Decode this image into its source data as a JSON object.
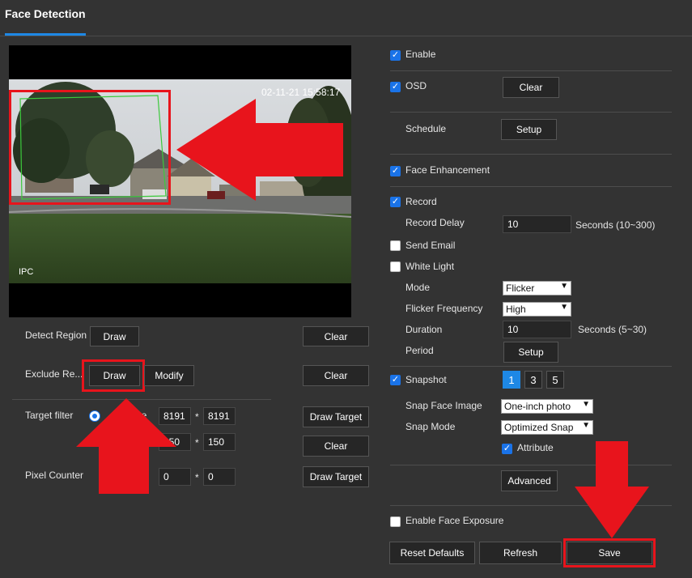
{
  "page": {
    "tab_title": "Face Detection"
  },
  "video": {
    "timestamp": "02-11-21 15:58:17",
    "channel_label": "IPC"
  },
  "left": {
    "detect_region_label": "Detect Region",
    "detect_draw": "Draw",
    "detect_clear": "Clear",
    "exclude_label": "Exclude Re...",
    "exclude_draw": "Draw",
    "exclude_modify": "Modify",
    "exclude_clear": "Clear",
    "target_filter_label": "Target filter",
    "size_label": "Size",
    "max_w": "8191",
    "max_h": "8191",
    "min_w": "150",
    "min_h": "150",
    "times": "*",
    "draw_target_1": "Draw Target",
    "clear_target": "Clear",
    "pixel_counter_label": "Pixel Counter",
    "pixel_w": "0",
    "pixel_h": "0",
    "draw_target_2": "Draw Target"
  },
  "right": {
    "enable": "Enable",
    "osd": "OSD",
    "osd_clear": "Clear",
    "schedule": "Schedule",
    "schedule_setup": "Setup",
    "face_enhancement": "Face Enhancement",
    "record": "Record",
    "record_delay": "Record Delay",
    "record_delay_value": "10",
    "record_delay_unit": "Seconds (10~300)",
    "send_email": "Send Email",
    "white_light": "White Light",
    "mode": "Mode",
    "mode_value": "Flicker",
    "flicker_frequency": "Flicker Frequency",
    "flicker_value": "High",
    "duration": "Duration",
    "duration_value": "10",
    "duration_unit": "Seconds (5~30)",
    "period": "Period",
    "period_setup": "Setup",
    "snapshot": "Snapshot",
    "snap_1": "1",
    "snap_3": "3",
    "snap_5": "5",
    "snap_face_image": "Snap Face Image",
    "snap_face_value": "One-inch photo",
    "snap_mode": "Snap Mode",
    "snap_mode_value": "Optimized Snap",
    "attribute": "Attribute",
    "advanced": "Advanced",
    "enable_face_exposure": "Enable Face Exposure"
  },
  "footer": {
    "reset": "Reset Defaults",
    "refresh": "Refresh",
    "save": "Save"
  },
  "colors": {
    "accent": "#1e88e5",
    "annotation": "#e8141c",
    "checkbox_on": "#1a73e8"
  }
}
